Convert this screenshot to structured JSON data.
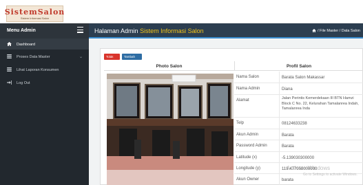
{
  "logo": {
    "main": "SistemSalon",
    "sub": "Sistem Informasi Salon"
  },
  "sidebar": {
    "title": "Menu Admin",
    "items": [
      {
        "label": "Dashboard",
        "icon": "home-icon"
      },
      {
        "label": "Proses Data Master",
        "icon": "grid-icon"
      },
      {
        "label": "Lihat Laporan Konsumen",
        "icon": "list-icon"
      },
      {
        "label": "Log Out",
        "icon": "logout-icon"
      }
    ]
  },
  "header": {
    "title_prefix": "Halaman Admin",
    "title_highlight": "Sistem Informasi Salon",
    "breadcrumb": "/  File Master  /  Data Salon"
  },
  "actions": {
    "delete_label": "Tolak",
    "add_label": "Tambah"
  },
  "columns": {
    "photo": "Photo Salon",
    "profile": "Profil Salon"
  },
  "profile": [
    {
      "key": "Nama Salon",
      "value": "Barata Salon Makassar"
    },
    {
      "key": "Nama Admin",
      "value": "Diana"
    },
    {
      "key": "Alamat",
      "value": "Jalan Perintis Kemerdekaan III BTN Hamzi Block C No. 22, Kelurahan Tamalanrea Indah, Tamalanrea Inda"
    },
    {
      "key": "Telp",
      "value": "08124633238"
    },
    {
      "key": "Akun Admin",
      "value": "Barata"
    },
    {
      "key": "Password Admin",
      "value": "Barata"
    },
    {
      "key": "Latitude (x)",
      "value": "-5.139030300000"
    },
    {
      "key": "Longitude (y)",
      "value": "119.477050000000"
    },
    {
      "key": "Akun Owner",
      "value": "barata"
    }
  ],
  "watermark": {
    "line1": "Activate Windows",
    "line2": "Go to Settings to activate Windows."
  },
  "colors": {
    "sidebar": "#22282e",
    "header": "#2c3e50",
    "accent": "#f5c518",
    "delete": "#d9342b",
    "add": "#2e6da4"
  }
}
